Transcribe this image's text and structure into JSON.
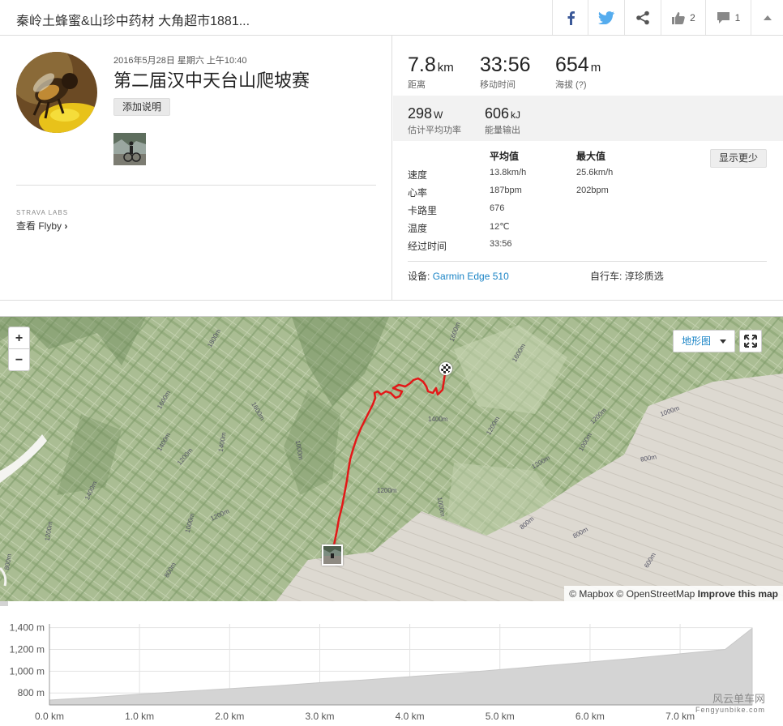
{
  "header": {
    "title": "秦岭土蜂蜜&山珍中药材 大角超市1881...",
    "facebook_icon": "facebook-icon",
    "twitter_icon": "twitter-icon",
    "share_icon": "share-icon",
    "kudos_count": "2",
    "comments_count": "1"
  },
  "activity": {
    "date": "2016年5月28日 星期六 上午10:40",
    "name": "第二届汉中天台山爬坡赛",
    "add_description": "添加说明"
  },
  "flyby": {
    "labs_label": "STRAVA LABS",
    "link": "查看 Flyby"
  },
  "stats": {
    "distance": {
      "value": "7.8",
      "unit": "km",
      "label": "距离"
    },
    "moving_time": {
      "value": "33:56",
      "label": "移动时间"
    },
    "elevation": {
      "value": "654",
      "unit": "m",
      "label": "海拔 (?)"
    },
    "power": {
      "value": "298",
      "unit": "W",
      "label": "估计平均功率"
    },
    "energy": {
      "value": "606",
      "unit": "kJ",
      "label": "能量输出"
    }
  },
  "details": {
    "avg_header": "平均值",
    "max_header": "最大值",
    "show_less": "显示更少",
    "rows": [
      {
        "label": "速度",
        "avg": "13.8km/h",
        "max": "25.6km/h"
      },
      {
        "label": "心率",
        "avg": "187bpm",
        "max": "202bpm"
      },
      {
        "label": "卡路里",
        "avg": "676",
        "max": ""
      },
      {
        "label": "温度",
        "avg": "12℃",
        "max": ""
      },
      {
        "label": "经过时间",
        "avg": "33:56",
        "max": ""
      }
    ],
    "device_label": "设备:",
    "device_value": "Garmin Edge 510",
    "bike_label": "自行车:",
    "bike_value": "淳珍质选"
  },
  "map": {
    "zoom_in": "+",
    "zoom_out": "−",
    "terrain_label": "地形图",
    "attribution_mapbox": "© Mapbox © OpenStreetMap",
    "improve": "Improve this map",
    "contour_labels": [
      "1600m",
      "1800m",
      "1600m",
      "1400m",
      "1200m",
      "1400m",
      "1200m",
      "1000m",
      "1600m",
      "1400m",
      "1200m",
      "1000m",
      "1200m",
      "800m",
      "800m",
      "1000m",
      "800m",
      "1200m",
      "1000m",
      "1200m",
      "800m",
      "600m",
      "1400m",
      "1200m",
      "1000m",
      "1600m",
      "800m"
    ]
  },
  "elevation_chart": {
    "y_ticks": [
      "1,400 m",
      "1,200 m",
      "1,000 m",
      "800 m"
    ],
    "x_ticks": [
      "0.0 km",
      "1.0 km",
      "2.0 km",
      "3.0 km",
      "4.0 km",
      "5.0 km",
      "6.0 km",
      "7.0 km"
    ]
  },
  "chart_data": {
    "type": "area",
    "xlabel": "",
    "ylabel": "",
    "x": [
      0,
      0.5,
      1.0,
      1.5,
      2.0,
      2.5,
      3.0,
      3.5,
      4.0,
      4.5,
      5.0,
      5.5,
      6.0,
      6.5,
      7.0,
      7.5,
      7.8
    ],
    "values": [
      735,
      760,
      790,
      815,
      840,
      865,
      895,
      920,
      950,
      980,
      1015,
      1050,
      1085,
      1120,
      1160,
      1200,
      1395
    ],
    "ylim": [
      690,
      1420
    ],
    "xlim": [
      0,
      7.8
    ],
    "grid": true
  },
  "watermark": {
    "line1": "风云单车网",
    "line2": "Fengyunbike.com"
  }
}
